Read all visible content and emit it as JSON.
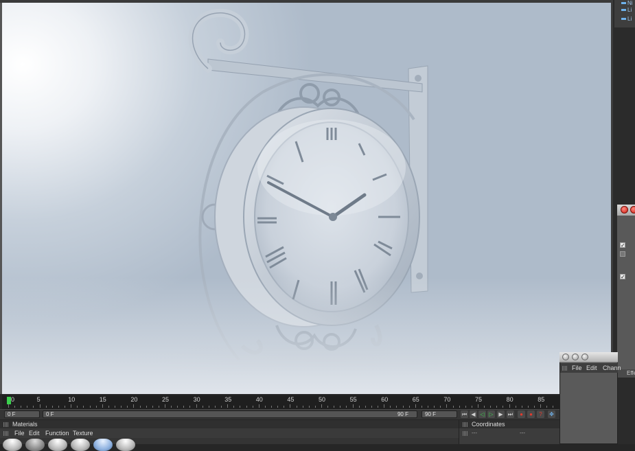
{
  "app": {
    "accent": "#3bd14d"
  },
  "object_list": {
    "items": [
      "Ni",
      "Li",
      "Li"
    ]
  },
  "timeline": {
    "ticks": [
      "0",
      "5",
      "10",
      "15",
      "20",
      "25",
      "30",
      "35",
      "40",
      "45",
      "50",
      "55",
      "60",
      "65",
      "70",
      "75",
      "80",
      "85"
    ],
    "current_frame": "0 F",
    "range_start": "0 F",
    "range_end": "90 F",
    "max_frame": "90 F"
  },
  "transport": {
    "buttons": [
      "go-to-start",
      "prev-key",
      "play-back",
      "play-forward",
      "next-key",
      "go-to-end",
      "record",
      "autokey",
      "keyframe",
      "move"
    ]
  },
  "materials": {
    "title": "Materials",
    "menu": [
      "File",
      "Edit",
      "Function",
      "Texture"
    ]
  },
  "coordinates": {
    "title": "Coordinates",
    "row": [
      "---",
      "---"
    ]
  },
  "floating_window": {
    "menu": [
      "File",
      "Edit",
      "Chann"
    ]
  },
  "attributes": {
    "tab_label": "Effe"
  }
}
